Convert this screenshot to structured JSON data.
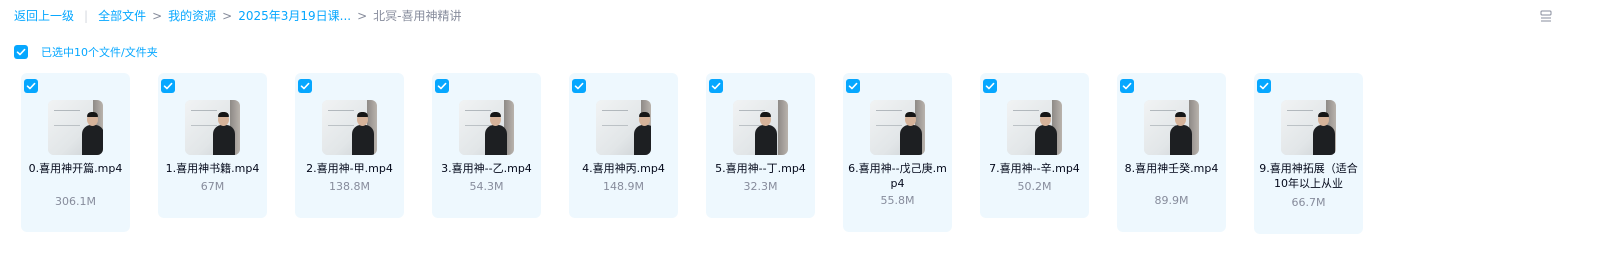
{
  "breadcrumb": {
    "back": "返回上一级",
    "items": [
      "全部文件",
      "我的资源",
      "2025年3月19日课..."
    ],
    "current": "北冥-喜用神精讲",
    "separator": ">"
  },
  "selection": {
    "text": "已选中10个文件/文件夹",
    "checked": true
  },
  "files": [
    {
      "name": "0.喜用神开篇.mp4",
      "size": "306.1M",
      "checked": true
    },
    {
      "name": "1.喜用神书籍.mp4",
      "size": "67M",
      "checked": true
    },
    {
      "name": "2.喜用神-甲.mp4",
      "size": "138.8M",
      "checked": true
    },
    {
      "name": "3.喜用神--乙.mp4",
      "size": "54.3M",
      "checked": true
    },
    {
      "name": "4.喜用神丙.mp4",
      "size": "148.9M",
      "checked": true
    },
    {
      "name": "5.喜用神--丁.mp4",
      "size": "32.3M",
      "checked": true
    },
    {
      "name": "6.喜用神--戊己庚.mp4",
      "size": "55.8M",
      "checked": true
    },
    {
      "name": "7.喜用神--辛.mp4",
      "size": "50.2M",
      "checked": true
    },
    {
      "name": "8.喜用神壬癸.mp4",
      "size": "89.9M",
      "checked": true
    },
    {
      "name": "9.喜用神拓展（适合10年以上从业",
      "size": "66.7M",
      "checked": true
    }
  ],
  "colors": {
    "accent": "#06a7ff",
    "card_bg": "#eef8fe",
    "muted_text": "#878c9c"
  },
  "icons": {
    "checkbox": "check-icon",
    "view_mode": "list-mode-icon"
  }
}
